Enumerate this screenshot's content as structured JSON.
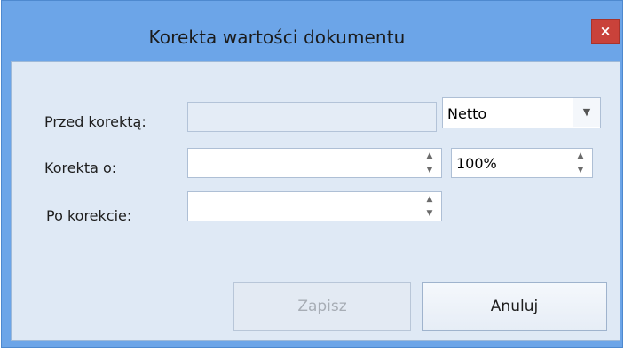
{
  "window": {
    "title": "Korekta wartości dokumentu",
    "close_label": "×"
  },
  "form": {
    "przed": {
      "label": "Przed korektą:",
      "value": ""
    },
    "type_select": {
      "value": "Netto"
    },
    "korekta": {
      "label": "Korekta o:",
      "value": ""
    },
    "percent": {
      "value": "100%"
    },
    "po": {
      "label": "Po korekcie:",
      "value": ""
    }
  },
  "buttons": {
    "save": "Zapisz",
    "cancel": "Anuluj"
  },
  "icons": {
    "spin_up": "▲",
    "spin_down": "▼",
    "dropdown": "▼"
  }
}
